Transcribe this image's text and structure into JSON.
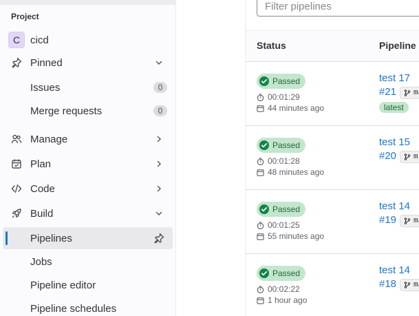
{
  "sidebar": {
    "section_label": "Project",
    "project": {
      "avatar_letter": "C",
      "name": "cicd"
    },
    "items": [
      {
        "label": "Pinned",
        "icon": "pin-icon"
      },
      {
        "label": "Issues",
        "count": "0"
      },
      {
        "label": "Merge requests",
        "count": "0"
      },
      {
        "label": "Manage",
        "icon": "users-icon"
      },
      {
        "label": "Plan",
        "icon": "calendar-icon"
      },
      {
        "label": "Code",
        "icon": "code-icon"
      },
      {
        "label": "Build",
        "icon": "rocket-icon"
      },
      {
        "label": "Pipelines",
        "active": true
      },
      {
        "label": "Jobs"
      },
      {
        "label": "Pipeline editor"
      },
      {
        "label": "Pipeline schedules"
      }
    ]
  },
  "main": {
    "filter_placeholder": "Filter pipelines",
    "columns": {
      "status": "Status",
      "pipeline": "Pipeline"
    },
    "rows": [
      {
        "status": "Passed",
        "duration": "00:01:29",
        "ago": "44 minutes ago",
        "name": "test 17",
        "id": "#21",
        "ref": "ma",
        "latest": "latest"
      },
      {
        "status": "Passed",
        "duration": "00:01:28",
        "ago": "48 minutes ago",
        "name": "test 15",
        "id": "#20",
        "ref": "m"
      },
      {
        "status": "Passed",
        "duration": "00:01:25",
        "ago": "55 minutes ago",
        "name": "test 14",
        "id": "#19",
        "ref": "ma"
      },
      {
        "status": "Passed",
        "duration": "00:02:22",
        "ago": "1 hour ago",
        "name": "test 14",
        "id": "#18",
        "ref": "ma"
      }
    ]
  },
  "colors": {
    "accent": "#1f75cb",
    "success_bg": "#c3e6cd",
    "success_fg": "#108548"
  }
}
